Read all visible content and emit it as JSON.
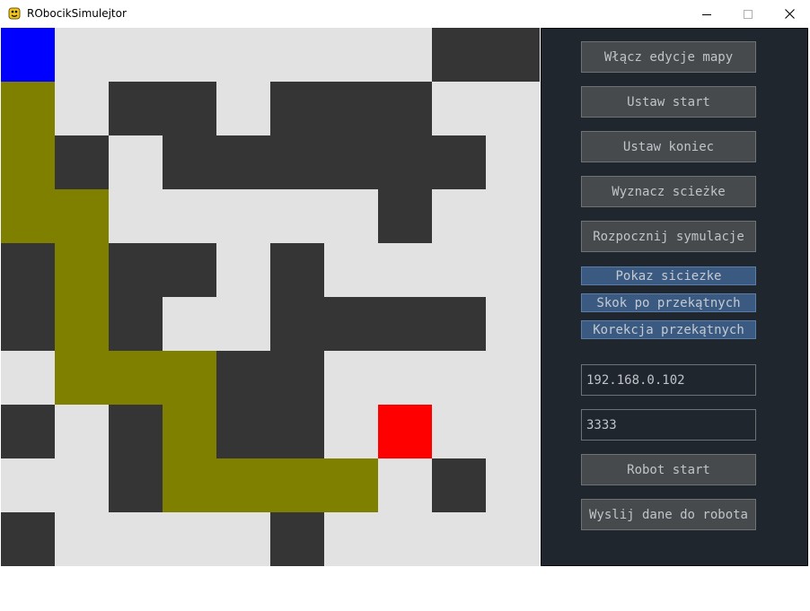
{
  "window": {
    "title": "RObocikSimulejtor",
    "app_icon": "python-snake-icon",
    "controls": [
      "minimize-icon",
      "maximize-icon",
      "close-icon"
    ]
  },
  "colors": {
    "empty": "#e2e2e2",
    "wall": "#353535",
    "path": "#808000",
    "start": "#0000ff",
    "end": "#ff0000",
    "panel_bg": "#20262e",
    "button_bg": "#464a4d",
    "toggle_bg": "#3b5a82"
  },
  "map": {
    "legend": {
      ".": "empty",
      "#": "wall",
      "P": "path",
      "S": "start",
      "E": "end"
    },
    "rows": [
      "S.......##",
      "P.##.###..",
      "P#.######.",
      "PP.....#..",
      "#P##.#....",
      "#P#..####.",
      ".PPP##....",
      "#.#P##.E..",
      "..#PPPP.#.",
      "#....#...."
    ]
  },
  "panel": {
    "edit_map_button": "Włącz edycje mapy",
    "set_start_button": "Ustaw start",
    "set_end_button": "Ustaw koniec",
    "find_path_button": "Wyznacz scieżke",
    "start_sim_button": "Rozpocznij symulacje",
    "show_path_toggle": "Pokaz siciezke",
    "diagonal_jump_toggle": "Skok po przekątnych",
    "diagonal_correction_toggle": "Korekcja przekątnych",
    "ip_field": "192.168.0.102",
    "port_field": "3333",
    "robot_start_button": "Robot start",
    "send_data_button": "Wyslij dane do robota"
  }
}
